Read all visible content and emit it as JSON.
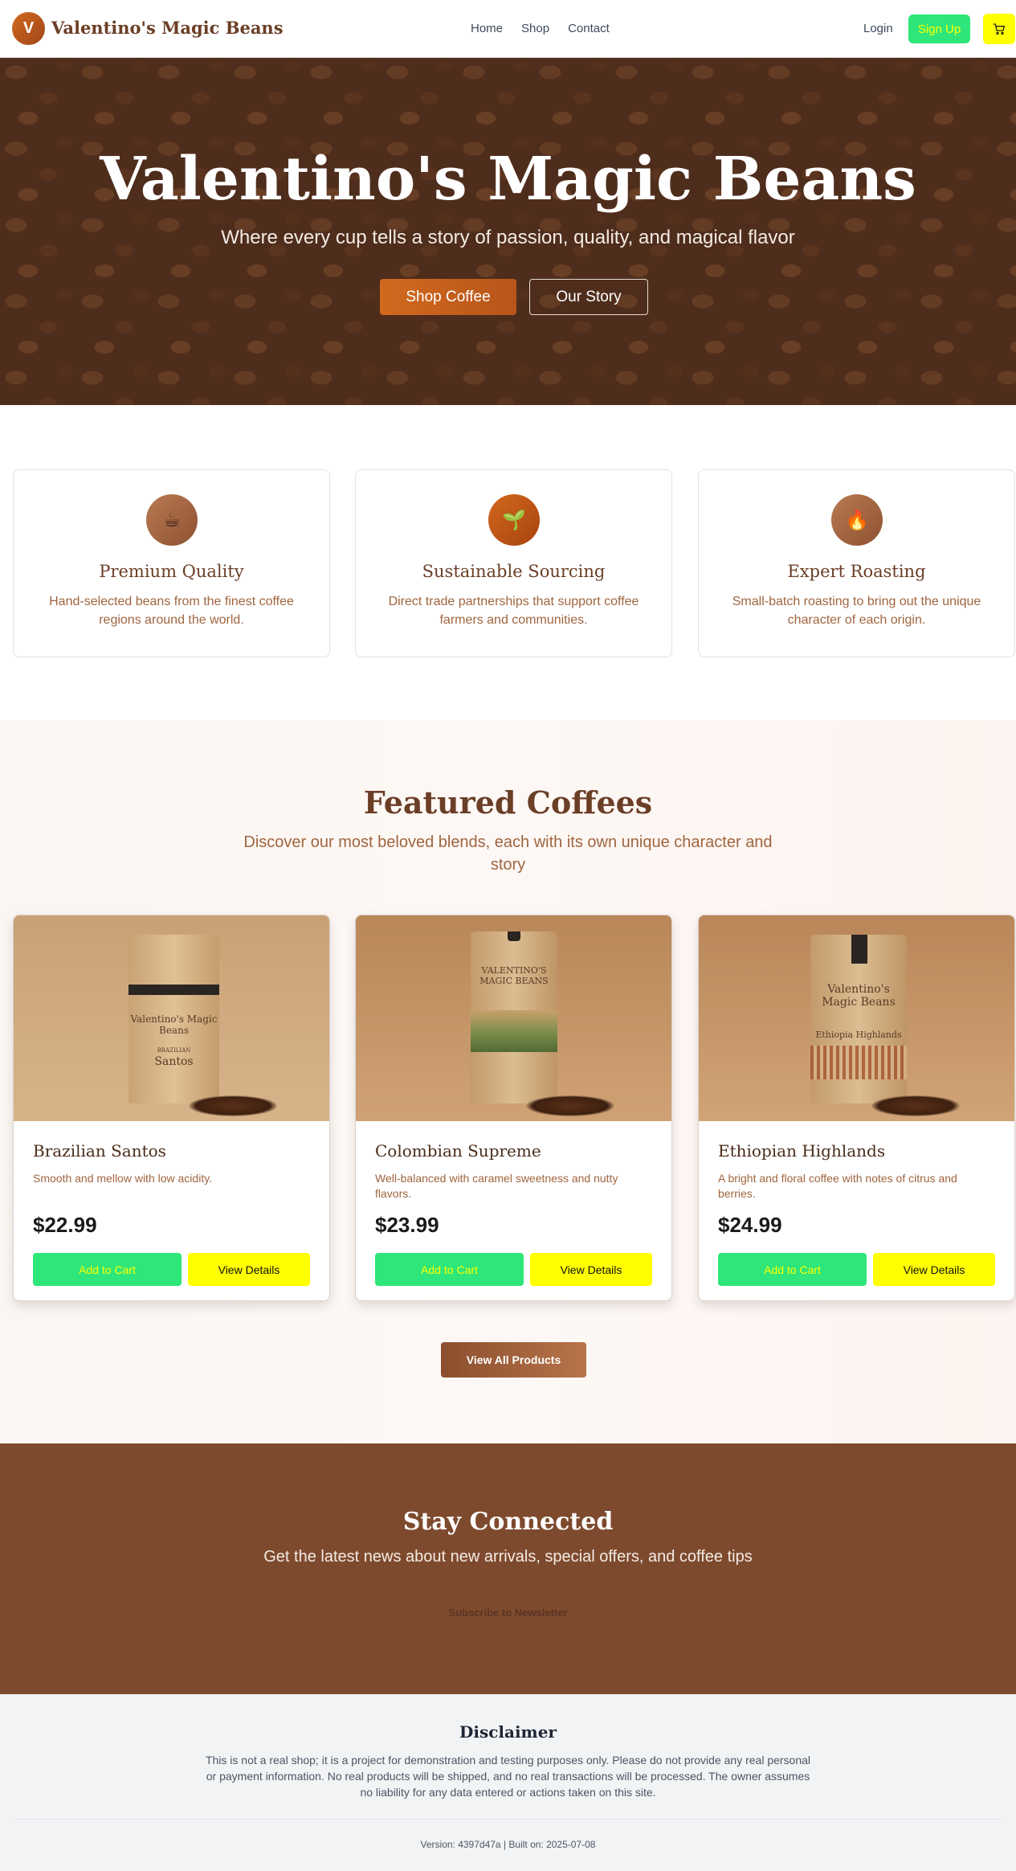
{
  "nav": {
    "logo_letter": "V",
    "brand": "Valentino's Magic Beans",
    "links": [
      "Home",
      "Shop",
      "Contact"
    ],
    "login": "Login",
    "signup": "Sign Up",
    "cart_icon": "cart-icon"
  },
  "hero": {
    "title": "Valentino's Magic Beans",
    "subtitle": "Where every cup tells a story of passion, quality, and magical flavor",
    "shop_button": "Shop Coffee",
    "story_button": "Our Story"
  },
  "features": [
    {
      "icon": "coffee-cup-icon",
      "glyph": "☕",
      "title": "Premium Quality",
      "text": "Hand-selected beans from the finest coffee regions around the world.",
      "color": "#a0653f"
    },
    {
      "icon": "seedling-icon",
      "glyph": "🌱",
      "title": "Sustainable Sourcing",
      "text": "Direct trade partnerships that support coffee farmers and communities.",
      "color": "#c2500f"
    },
    {
      "icon": "flame-icon",
      "glyph": "🔥",
      "title": "Expert Roasting",
      "text": "Small-batch roasting to bring out the unique character of each origin.",
      "color": "#a0653f"
    }
  ],
  "featured": {
    "title": "Featured Coffees",
    "subtitle": "Discover our most beloved blends, each with its own unique character and story",
    "products": [
      {
        "name": "Brazilian Santos",
        "description": "Smooth and mellow with low acidity.",
        "price": "$22.99",
        "add_label": "Add to Cart",
        "view_label": "View Details",
        "bag_brand": "Valentino's Magic Beans",
        "bag_origin_top": "BRAZILIAN",
        "bag_origin": "Santos"
      },
      {
        "name": "Colombian Supreme",
        "description": "Well-balanced with caramel sweetness and nutty flavors.",
        "price": "$23.99",
        "add_label": "Add to Cart",
        "view_label": "View Details",
        "bag_brand": "VALENTINO'S MAGIC BEANS",
        "bag_origin_top": "",
        "bag_origin": ""
      },
      {
        "name": "Ethiopian Highlands",
        "description": "A bright and floral coffee with notes of citrus and berries.",
        "price": "$24.99",
        "add_label": "Add to Cart",
        "view_label": "View Details",
        "bag_brand": "Valentino's Magic Beans",
        "bag_origin_top": "",
        "bag_origin": "Ethiopia Highlands"
      }
    ],
    "view_all": "View All Products"
  },
  "newsletter": {
    "title": "Stay Connected",
    "subtitle": "Get the latest news about new arrivals, special offers, and coffee tips",
    "button": "Subscribe to Newsletter"
  },
  "footer": {
    "disclaimer_title": "Disclaimer",
    "disclaimer_text": "This is not a real shop; it is a project for demonstration and testing purposes only. Please do not provide any real personal or payment information. No real products will be shipped, and no real transactions will be processed. The owner assumes no liability for any data entered or actions taken on this site.",
    "version": "Version: 4397d47a | Built on: 2025-07-08"
  }
}
